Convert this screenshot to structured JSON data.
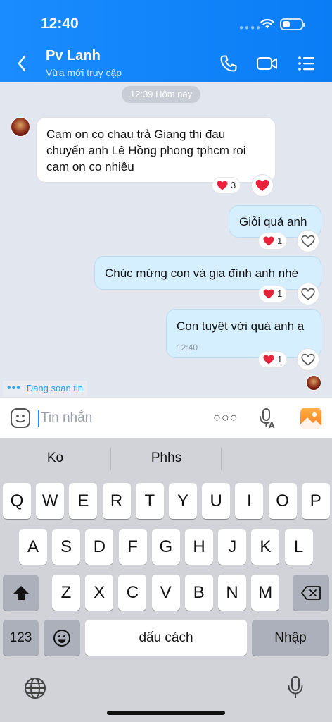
{
  "status_bar": {
    "time": "12:40",
    "battery_level_percent": 40
  },
  "header": {
    "contact_name": "Pv Lanh",
    "contact_status": "Vừa mới truy cập"
  },
  "chat": {
    "date_pill": "12:39 Hôm nay",
    "messages": [
      {
        "direction": "in",
        "text": "Cam on co chau trả Giang thi đau chuyển anh Lê Hồng phong tphcm roi cam on co nhiêu",
        "reaction_count": "3"
      },
      {
        "direction": "out",
        "text": "Giỏi quá anh",
        "reaction_count": "1"
      },
      {
        "direction": "out",
        "text": "Chúc mừng con và gia đình anh nhé",
        "reaction_count": "1"
      },
      {
        "direction": "out",
        "text": "Con tuyệt vời quá anh ạ",
        "time": "12:40",
        "reaction_count": "1"
      }
    ],
    "typing_indicator": "Đang soạn tin"
  },
  "input": {
    "placeholder": "Tin nhắn"
  },
  "keyboard": {
    "suggestions": [
      "Ko",
      "Phhs",
      ""
    ],
    "row1": [
      "Q",
      "W",
      "E",
      "R",
      "T",
      "Y",
      "U",
      "I",
      "O",
      "P"
    ],
    "row2": [
      "A",
      "S",
      "D",
      "F",
      "G",
      "H",
      "J",
      "K",
      "L"
    ],
    "row3": [
      "Z",
      "X",
      "C",
      "V",
      "B",
      "N",
      "M"
    ],
    "numbers_key": "123",
    "space_key": "dấu cách",
    "return_key": "Nhập"
  },
  "colors": {
    "header": "#0a7df5",
    "accent": "#1a8cff",
    "out_bubble": "#d5efff",
    "heart": "#e8223a"
  }
}
